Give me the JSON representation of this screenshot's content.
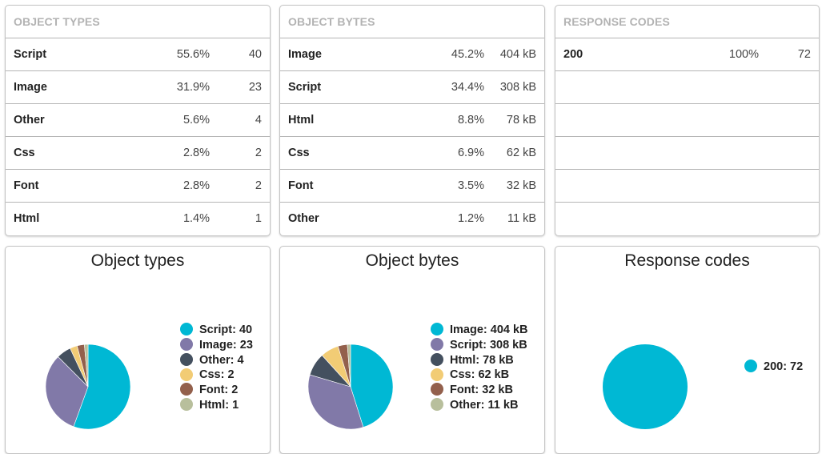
{
  "tables": [
    {
      "title": "OBJECT TYPES",
      "rows": [
        {
          "name": "Script",
          "pct": "55.6%",
          "value": "40"
        },
        {
          "name": "Image",
          "pct": "31.9%",
          "value": "23"
        },
        {
          "name": "Other",
          "pct": "5.6%",
          "value": "4"
        },
        {
          "name": "Css",
          "pct": "2.8%",
          "value": "2"
        },
        {
          "name": "Font",
          "pct": "2.8%",
          "value": "2"
        },
        {
          "name": "Html",
          "pct": "1.4%",
          "value": "1"
        }
      ]
    },
    {
      "title": "OBJECT BYTES",
      "rows": [
        {
          "name": "Image",
          "pct": "45.2%",
          "value": "404 kB"
        },
        {
          "name": "Script",
          "pct": "34.4%",
          "value": "308 kB"
        },
        {
          "name": "Html",
          "pct": "8.8%",
          "value": "78 kB"
        },
        {
          "name": "Css",
          "pct": "6.9%",
          "value": "62 kB"
        },
        {
          "name": "Font",
          "pct": "3.5%",
          "value": "32 kB"
        },
        {
          "name": "Other",
          "pct": "1.2%",
          "value": "11 kB"
        }
      ]
    },
    {
      "title": "RESPONSE CODES",
      "rows": [
        {
          "name": "200",
          "pct": "100%",
          "value": "72"
        },
        {
          "name": "",
          "pct": "",
          "value": ""
        },
        {
          "name": "",
          "pct": "",
          "value": ""
        },
        {
          "name": "",
          "pct": "",
          "value": ""
        },
        {
          "name": "",
          "pct": "",
          "value": ""
        },
        {
          "name": "",
          "pct": "",
          "value": ""
        }
      ]
    }
  ],
  "chart_data": [
    {
      "type": "pie",
      "title": "Object types",
      "legend_position": "right",
      "slices": [
        {
          "label": "Script",
          "value": 40,
          "legend": "Script: 40",
          "color": "#00b8d4"
        },
        {
          "label": "Image",
          "value": 23,
          "legend": "Image: 23",
          "color": "#8179a8"
        },
        {
          "label": "Other",
          "value": 4,
          "legend": "Other: 4",
          "color": "#44505f"
        },
        {
          "label": "Css",
          "value": 2,
          "legend": "Css: 2",
          "color": "#f2cc75"
        },
        {
          "label": "Font",
          "value": 2,
          "legend": "Font: 2",
          "color": "#93604c"
        },
        {
          "label": "Html",
          "value": 1,
          "legend": "Html: 1",
          "color": "#b8bf9c"
        }
      ]
    },
    {
      "type": "pie",
      "title": "Object bytes",
      "legend_position": "right",
      "slices": [
        {
          "label": "Image",
          "value": 404,
          "legend": "Image: 404 kB",
          "color": "#00b8d4"
        },
        {
          "label": "Script",
          "value": 308,
          "legend": "Script: 308 kB",
          "color": "#8179a8"
        },
        {
          "label": "Html",
          "value": 78,
          "legend": "Html: 78 kB",
          "color": "#44505f"
        },
        {
          "label": "Css",
          "value": 62,
          "legend": "Css: 62 kB",
          "color": "#f2cc75"
        },
        {
          "label": "Font",
          "value": 32,
          "legend": "Font: 32 kB",
          "color": "#93604c"
        },
        {
          "label": "Other",
          "value": 11,
          "legend": "Other: 11 kB",
          "color": "#b8bf9c"
        }
      ]
    },
    {
      "type": "pie",
      "title": "Response codes",
      "legend_position": "right",
      "slices": [
        {
          "label": "200",
          "value": 72,
          "legend": "200: 72",
          "color": "#00b8d4"
        }
      ]
    }
  ]
}
